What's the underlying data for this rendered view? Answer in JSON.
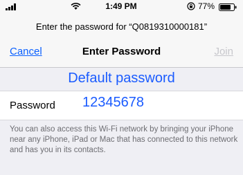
{
  "status_bar": {
    "time": "1:49 PM",
    "battery": "77%",
    "icons": [
      "signal-icon",
      "wifi-icon",
      "orientation-lock-icon",
      "battery-icon"
    ]
  },
  "prompt": "Enter the password for “Q0819310000181”",
  "navbar": {
    "cancel_label": "Cancel",
    "title": "Enter Password",
    "join_label": "Join"
  },
  "annotation": "Default password",
  "password_field": {
    "label": "Password",
    "value": "12345678"
  },
  "footer": "You can also access this Wi-Fi network by bringing your iPhone near any iPhone, iPad or Mac that has connected to this network and has you in its contacts.",
  "colors": {
    "accent": "#0a60ff",
    "annotation": "#1a5bff",
    "disabled": "#c7c7cc"
  }
}
